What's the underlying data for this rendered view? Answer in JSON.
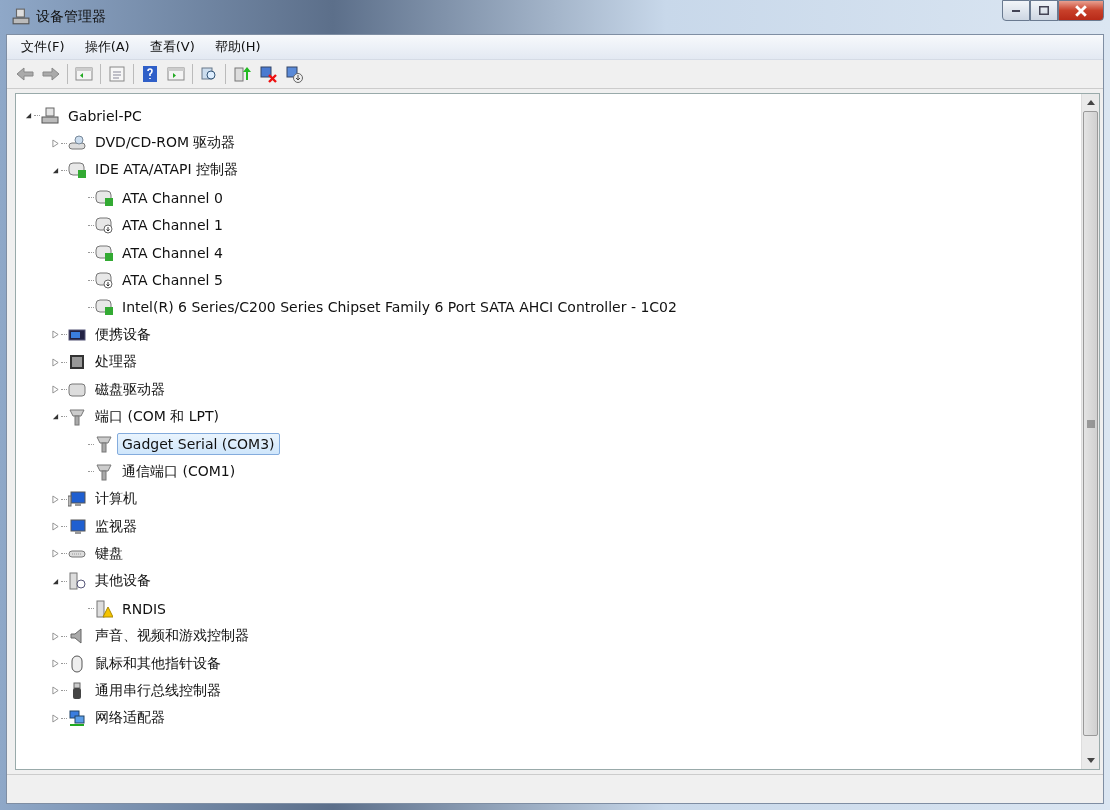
{
  "window": {
    "title": "设备管理器"
  },
  "menu": [
    {
      "label": "文件(F)"
    },
    {
      "label": "操作(A)"
    },
    {
      "label": "查看(V)"
    },
    {
      "label": "帮助(H)"
    }
  ],
  "tree": [
    {
      "label": "Gabriel-PC",
      "kind": "computer",
      "expanded": true,
      "selected": false,
      "children": [
        {
          "label": "DVD/CD-ROM 驱动器",
          "kind": "dvd",
          "expanded": false,
          "selected": false
        },
        {
          "label": "IDE ATA/ATAPI 控制器",
          "kind": "ide",
          "expanded": true,
          "selected": false,
          "children": [
            {
              "label": "ATA Channel 0",
              "kind": "ide",
              "selected": false
            },
            {
              "label": "ATA Channel 1",
              "kind": "ide-down",
              "selected": false
            },
            {
              "label": "ATA Channel 4",
              "kind": "ide",
              "selected": false
            },
            {
              "label": "ATA Channel 5",
              "kind": "ide-down",
              "selected": false
            },
            {
              "label": "Intel(R) 6 Series/C200 Series Chipset Family 6 Port SATA AHCI Controller - 1C02",
              "kind": "ide",
              "selected": false
            }
          ]
        },
        {
          "label": "便携设备",
          "kind": "portable",
          "expanded": false,
          "selected": false
        },
        {
          "label": "处理器",
          "kind": "cpu",
          "expanded": false,
          "selected": false
        },
        {
          "label": "磁盘驱动器",
          "kind": "disk",
          "expanded": false,
          "selected": false
        },
        {
          "label": "端口 (COM 和 LPT)",
          "kind": "port",
          "expanded": true,
          "selected": false,
          "children": [
            {
              "label": "Gadget Serial (COM3)",
              "kind": "port",
              "selected": true
            },
            {
              "label": "通信端口 (COM1)",
              "kind": "port",
              "selected": false
            }
          ]
        },
        {
          "label": "计算机",
          "kind": "pc",
          "expanded": false,
          "selected": false
        },
        {
          "label": "监视器",
          "kind": "monitor",
          "expanded": false,
          "selected": false
        },
        {
          "label": "键盘",
          "kind": "keyboard",
          "expanded": false,
          "selected": false
        },
        {
          "label": "其他设备",
          "kind": "unknown",
          "expanded": true,
          "selected": false,
          "children": [
            {
              "label": "RNDIS",
              "kind": "warning",
              "selected": false
            }
          ]
        },
        {
          "label": "声音、视频和游戏控制器",
          "kind": "sound",
          "expanded": false,
          "selected": false
        },
        {
          "label": "鼠标和其他指针设备",
          "kind": "mouse",
          "expanded": false,
          "selected": false
        },
        {
          "label": "通用串行总线控制器",
          "kind": "usb",
          "expanded": false,
          "selected": false
        },
        {
          "label": "网络适配器",
          "kind": "network",
          "expanded": false,
          "selected": false
        }
      ]
    }
  ]
}
